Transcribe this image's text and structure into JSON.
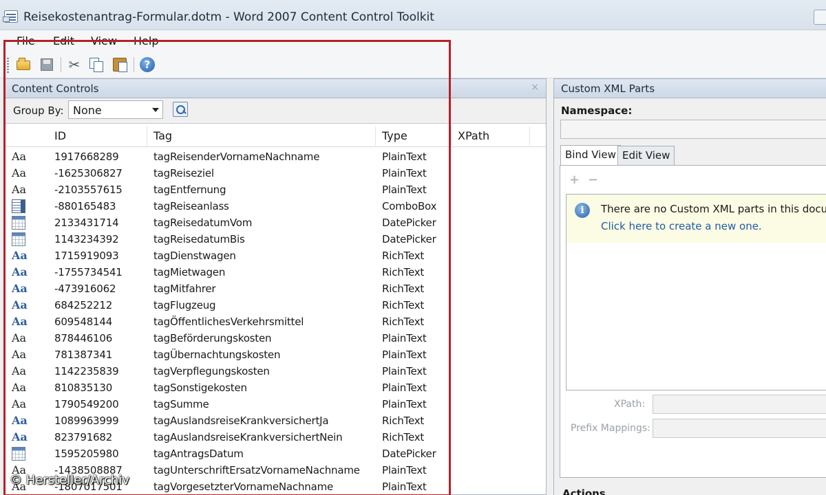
{
  "window": {
    "title": "Reisekostenantrag-Formular.dotm - Word 2007 Content Control Toolkit"
  },
  "menu": [
    "File",
    "Edit",
    "View",
    "Help"
  ],
  "toolbar": {
    "icons": [
      "open-folder-icon",
      "save-icon",
      "cut-icon",
      "copy-icon",
      "paste-icon",
      "help-icon"
    ]
  },
  "left_panel": {
    "title": "Content Controls",
    "close": "×",
    "group_by_label": "Group By:",
    "group_by_value": "None",
    "columns": {
      "id": "ID",
      "tag": "Tag",
      "type": "Type",
      "xpath": "XPath"
    },
    "rows": [
      {
        "icon": "plain",
        "id": "1917668289",
        "tag": "tagReisenderVornameNachname",
        "type": "PlainText"
      },
      {
        "icon": "plain",
        "id": "-1625306827",
        "tag": "tagReiseziel",
        "type": "PlainText"
      },
      {
        "icon": "plain",
        "id": "-2103557615",
        "tag": "tagEntfernung",
        "type": "PlainText"
      },
      {
        "icon": "combo",
        "id": "-880165483",
        "tag": "tagReiseanlass",
        "type": "ComboBox"
      },
      {
        "icon": "date",
        "id": "2133431714",
        "tag": "tagReisedatumVom",
        "type": "DatePicker"
      },
      {
        "icon": "date",
        "id": "1143234392",
        "tag": "tagReisedatumBis",
        "type": "DatePicker"
      },
      {
        "icon": "rich",
        "id": "1715919093",
        "tag": "tagDienstwagen",
        "type": "RichText"
      },
      {
        "icon": "rich",
        "id": "-1755734541",
        "tag": "tagMietwagen",
        "type": "RichText"
      },
      {
        "icon": "rich",
        "id": "-473916062",
        "tag": "tagMitfahrer",
        "type": "RichText"
      },
      {
        "icon": "rich",
        "id": "684252212",
        "tag": "tagFlugzeug",
        "type": "RichText"
      },
      {
        "icon": "rich",
        "id": "609548144",
        "tag": "tagÖffentlichesVerkehrsmittel",
        "type": "RichText"
      },
      {
        "icon": "plain",
        "id": "878446106",
        "tag": "tagBeförderungskosten",
        "type": "PlainText"
      },
      {
        "icon": "plain",
        "id": "781387341",
        "tag": "tagÜbernachtungskosten",
        "type": "PlainText"
      },
      {
        "icon": "plain",
        "id": "1142235839",
        "tag": "tagVerpflegungskosten",
        "type": "PlainText"
      },
      {
        "icon": "plain",
        "id": "810835130",
        "tag": "tagSonstigekosten",
        "type": "PlainText"
      },
      {
        "icon": "plain",
        "id": "1790549200",
        "tag": "tagSumme",
        "type": "PlainText"
      },
      {
        "icon": "rich",
        "id": "1089963999",
        "tag": "tagAuslandsreiseKrankversichertJa",
        "type": "RichText"
      },
      {
        "icon": "rich",
        "id": "823791682",
        "tag": "tagAuslandsreiseKrankversichertNein",
        "type": "RichText"
      },
      {
        "icon": "date",
        "id": "1595205980",
        "tag": "tagAntragsDatum",
        "type": "DatePicker"
      },
      {
        "icon": "plain",
        "id": "-1438508887",
        "tag": "tagUnterschriftErsatzVornameNachname",
        "type": "PlainText"
      },
      {
        "icon": "plain",
        "id": "-1807017501",
        "tag": "tagVorgesetzterVornameNachname",
        "type": "PlainText"
      }
    ],
    "icon_glyph": "Aa"
  },
  "right_panel": {
    "title": "Custom XML Parts",
    "namespace_label": "Namespace:",
    "tabs": [
      "Bind View",
      "Edit View"
    ],
    "add": "+",
    "remove": "−",
    "info_text": "There are no Custom XML parts in this document.",
    "info_link": "Click here to create a new one.",
    "xpath_label": "XPath:",
    "prefix_label": "Prefix Mappings:",
    "actions_label": "Actions"
  },
  "watermark": "© Hersteller/Archiv",
  "colors": {
    "highlight": "#b5202a",
    "link": "#1f5ca8",
    "rich_icon": "#2f5f9e"
  }
}
